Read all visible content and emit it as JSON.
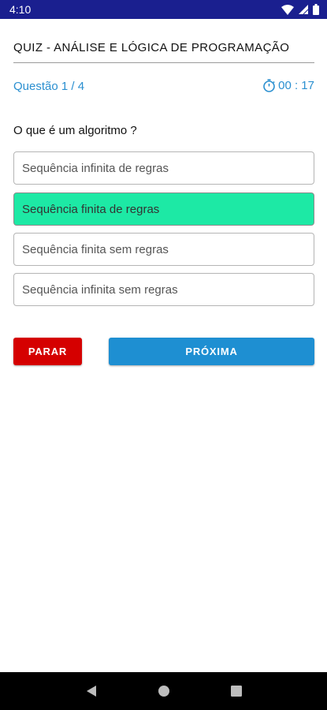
{
  "status_bar": {
    "time": "4:10",
    "icons": [
      "wifi-icon",
      "signal-icon",
      "battery-icon"
    ]
  },
  "quiz": {
    "title": "QUIZ - ANÁLISE E LÓGICA DE PROGRAMAÇÃO",
    "counter": "Questão 1 / 4",
    "timer": "00 : 17",
    "question": "O que é um algoritmo ?",
    "options": [
      {
        "label": "Sequência infinita de regras",
        "selected": false
      },
      {
        "label": "Sequência finita de regras",
        "selected": true
      },
      {
        "label": "Sequência finita sem regras",
        "selected": false
      },
      {
        "label": "Sequência infinita sem regras",
        "selected": false
      }
    ]
  },
  "actions": {
    "stop_label": "PARAR",
    "next_label": "PRÓXIMA"
  },
  "colors": {
    "status_bar": "#1a1f8f",
    "accent": "#2a8fd0",
    "selected_option": "#1de9a5",
    "stop_button": "#d50000",
    "next_button": "#1e8fd2"
  },
  "nav_bar": {
    "icons": [
      "back-icon",
      "home-icon",
      "recents-icon"
    ]
  }
}
